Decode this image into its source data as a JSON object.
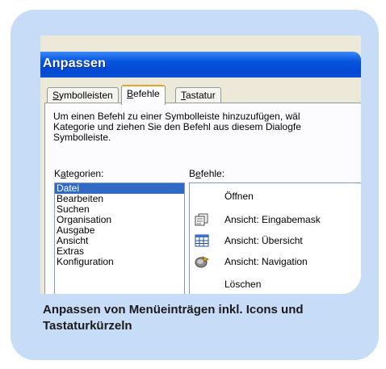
{
  "window": {
    "title": "Anpassen"
  },
  "tabs": [
    {
      "label": "Symbolleisten",
      "accel": "S",
      "rest": "ymbolleisten"
    },
    {
      "label": "Befehle",
      "accel": "B",
      "rest": "efehle"
    },
    {
      "label": "Tastatur",
      "accel": "T",
      "rest": "astatur"
    }
  ],
  "active_tab": "Befehle",
  "description": "Um einen Befehl zu einer Symbolleiste hinzuzufügen, wäl\nKategorie und ziehen Sie den Befehl aus diesem Dialogfe\nSymbolleiste.",
  "categories_label": {
    "pre": "K",
    "accel": "a",
    "post": "tegorien:"
  },
  "commands_label": {
    "pre": "B",
    "accel": "e",
    "post": "fehle:"
  },
  "categories": [
    "Datei",
    "Bearbeiten",
    "Suchen",
    "Organisation",
    "Ausgabe",
    "Ansicht",
    "Extras",
    "Konfiguration"
  ],
  "selected_category": "Datei",
  "commands": [
    {
      "label": "Öffnen",
      "icon": ""
    },
    {
      "label": "Ansicht: Eingabemask",
      "icon": "form-icon"
    },
    {
      "label": "Ansicht: Übersicht",
      "icon": "table-icon"
    },
    {
      "label": "Ansicht: Navigation",
      "icon": "navigation-icon"
    },
    {
      "label": "Löschen",
      "icon": ""
    }
  ],
  "caption": "Anpassen von Menüeinträgen inkl. Icons und Tastaturkürzeln",
  "colors": {
    "card": "#c7dcf7",
    "titlebar": "#0758e0",
    "selection": "#316ac5",
    "tab_highlight": "#e6a32b"
  }
}
